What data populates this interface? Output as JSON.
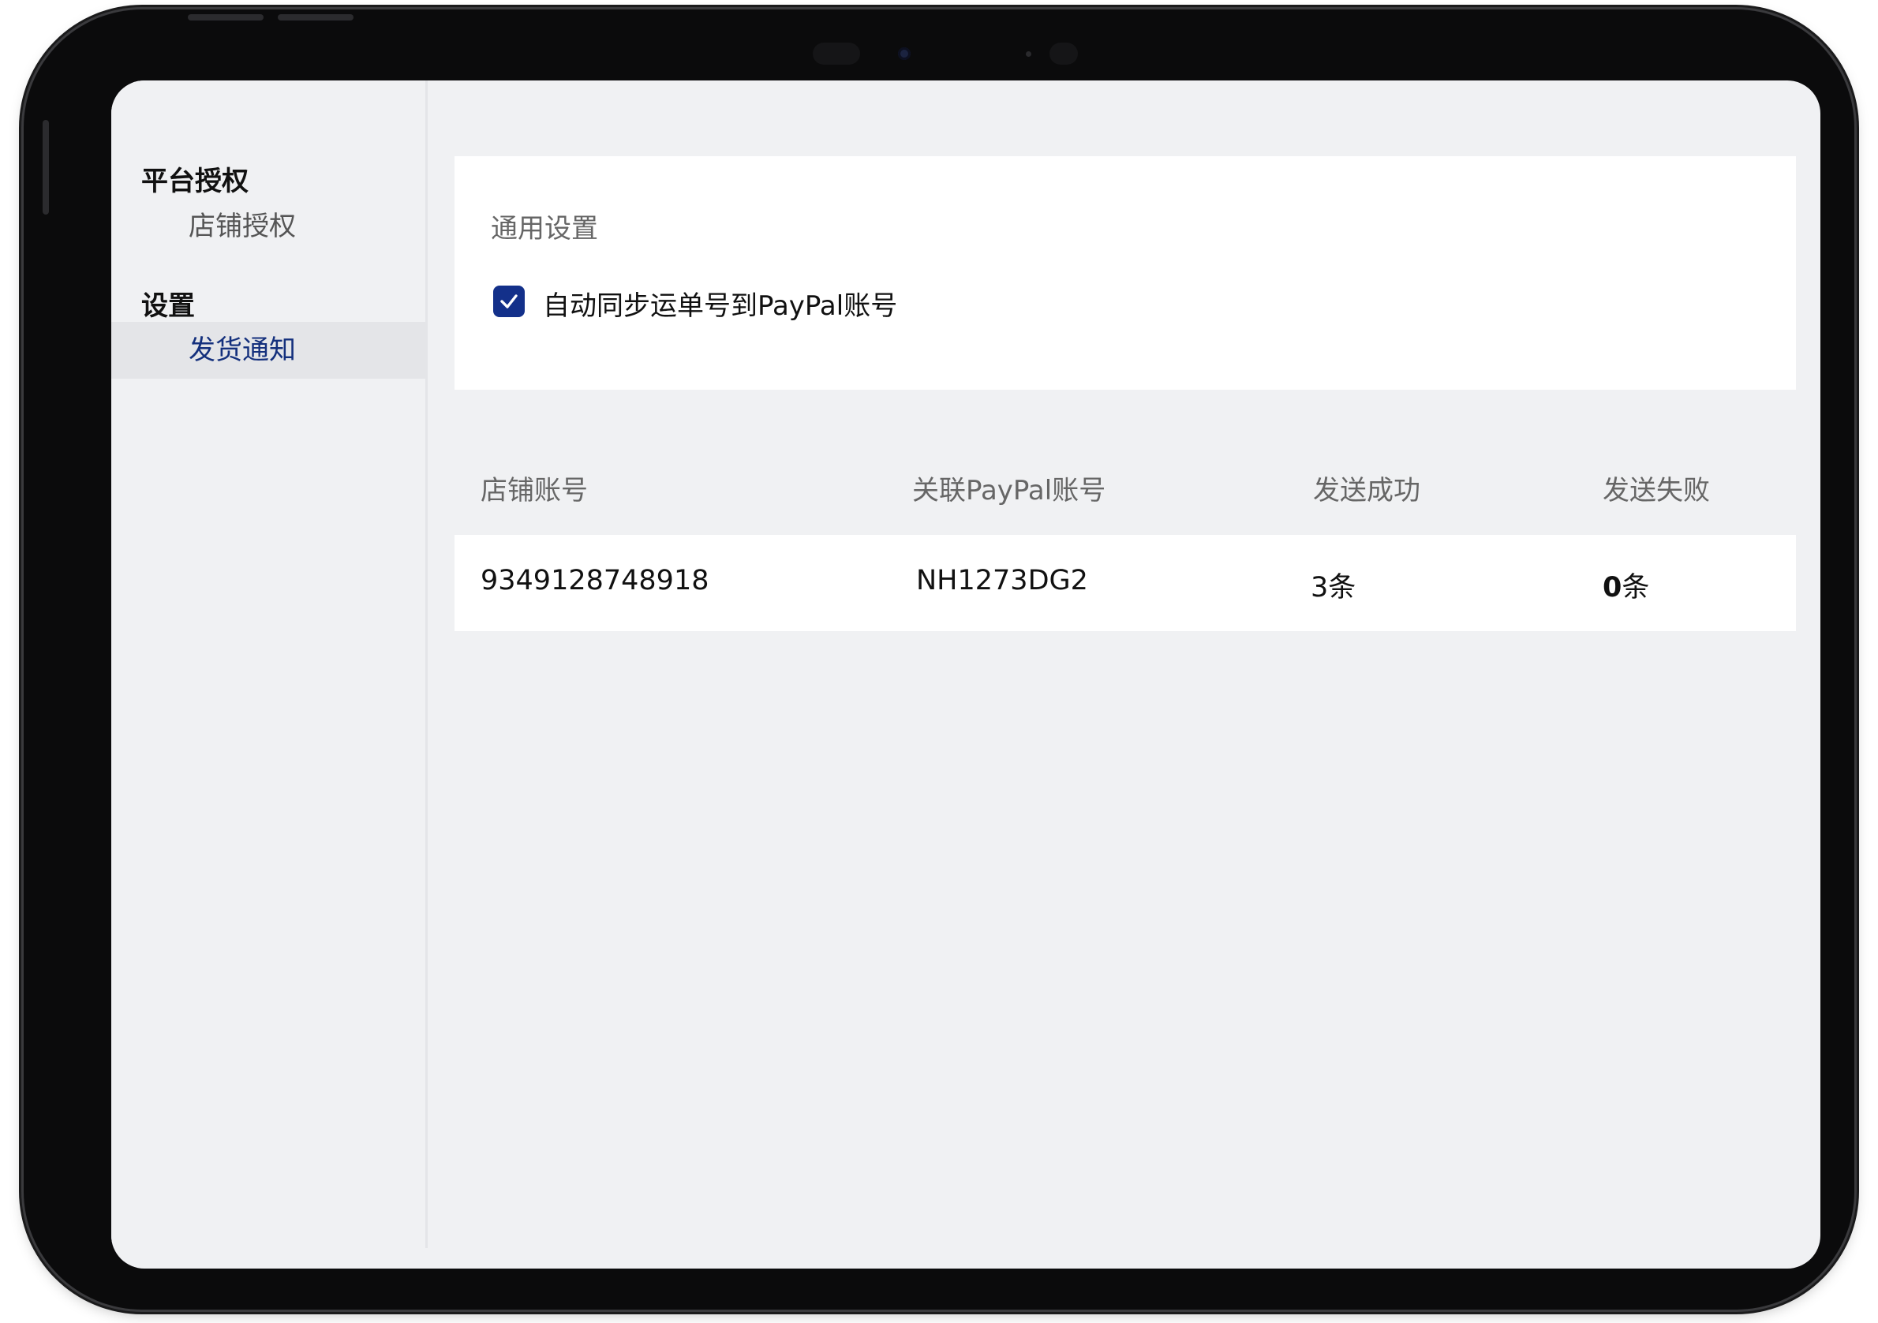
{
  "sidebar": {
    "groups": [
      {
        "title": "平台授权",
        "items": [
          {
            "label": "店铺授权",
            "active": false
          }
        ]
      },
      {
        "title": "设置",
        "items": [
          {
            "label": "发货通知",
            "active": true
          }
        ]
      }
    ]
  },
  "settings_card": {
    "title": "通用设置",
    "auto_sync": {
      "checked": true,
      "label": "自动同步运单号到PayPal账号"
    }
  },
  "table": {
    "columns": [
      "店铺账号",
      "关联PayPal账号",
      "发送成功",
      "发送失败"
    ],
    "rows": [
      {
        "store_account": "9349128748918",
        "paypal_account": "NH1273DG2",
        "success_count": "3",
        "success_unit": "条",
        "fail_count": "0",
        "fail_unit": "条"
      }
    ]
  },
  "colors": {
    "accent": "#13308a",
    "active_nav_text": "#14307d",
    "screen_background": "#f0f1f3"
  }
}
